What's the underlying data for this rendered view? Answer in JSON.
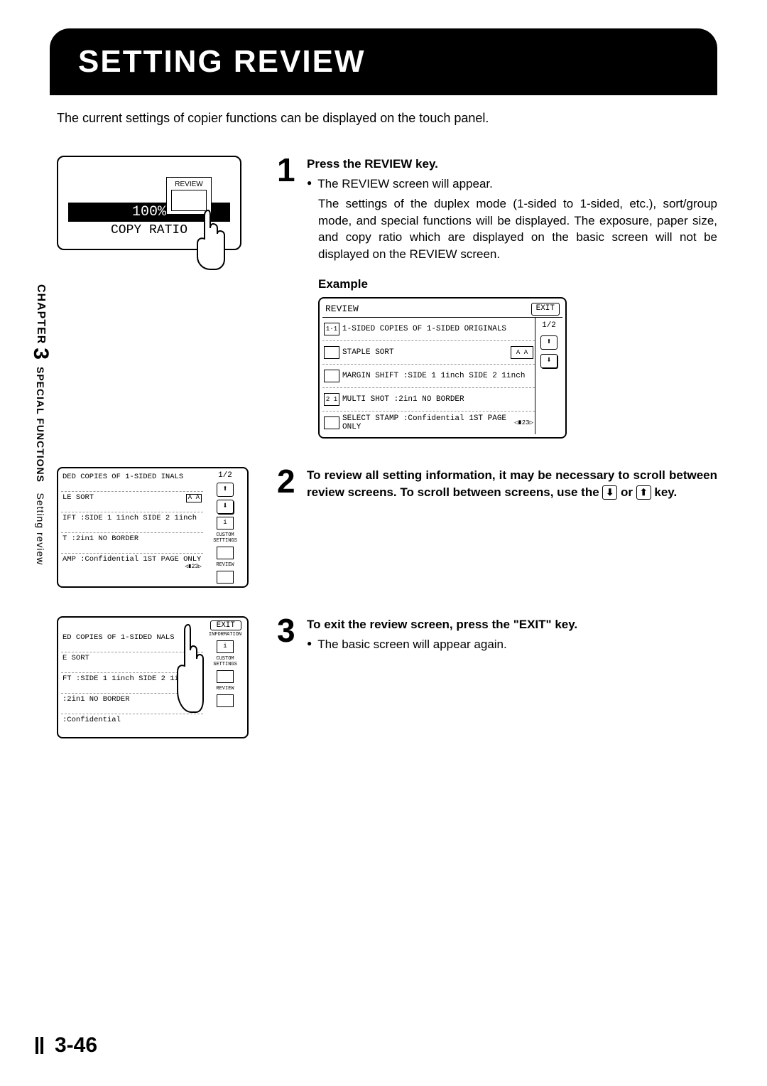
{
  "title": "SETTING REVIEW",
  "intro": "The current settings of copier functions can be displayed on the touch panel.",
  "sidebar": {
    "chapter_label": "CHAPTER",
    "chapter_num": "3",
    "section": "SPECIAL FUNCTIONS",
    "sub": "Setting review"
  },
  "fig1": {
    "review_label": "REVIEW",
    "ratio_value": "100%",
    "ratio_label": "COPY RATIO"
  },
  "step1": {
    "num": "1",
    "heading": "Press the REVIEW key.",
    "bullet": "The REVIEW screen will appear.",
    "para": "The settings of the duplex mode (1-sided to 1-sided, etc.), sort/group mode, and special functions will be displayed. The exposure, paper size, and copy ratio which are displayed on the basic screen will not be displayed on the REVIEW screen.",
    "example_label": "Example"
  },
  "review_screen": {
    "title": "REVIEW",
    "exit": "EXIT",
    "page": "1/2",
    "rows": [
      "1-SIDED COPIES OF 1-SIDED ORIGINALS",
      "STAPLE SORT",
      "MARGIN SHIFT :SIDE 1 1inch   SIDE 2 1inch",
      "MULTI SHOT :2in1 NO BORDER",
      "SELECT STAMP :Confidential 1ST PAGE ONLY"
    ]
  },
  "step2": {
    "num": "2",
    "text_a": "To review all setting information, it may be necessary to scroll between review screens. To scroll between screens, use the ",
    "text_b": " or ",
    "text_c": " key."
  },
  "mini2": {
    "page": "1/2",
    "side_labels": [
      "CUSTOM SETTINGS",
      "REVIEW"
    ],
    "rows": [
      "DED COPIES OF 1-SIDED INALS",
      "LE SORT",
      "IFT :SIDE 1 1inch   SIDE 2 1inch",
      "T :2in1 NO BORDER",
      "AMP :Confidential 1ST PAGE ONLY"
    ]
  },
  "step3": {
    "num": "3",
    "heading": "To exit the review screen, press the \"EXIT\" key.",
    "bullet": "The basic screen will appear again."
  },
  "mini3": {
    "exit": "EXIT",
    "side_labels": [
      "INFORMATION",
      "CUSTOM SETTINGS",
      "REVIEW"
    ],
    "rows": [
      "ED COPIES OF 1-SIDED NALS",
      "E SORT",
      "FT :SIDE 1 1inch   SIDE 2 1i",
      ":2in1 NO BORDER",
      ":Confidential"
    ]
  },
  "page_number": "3-46"
}
